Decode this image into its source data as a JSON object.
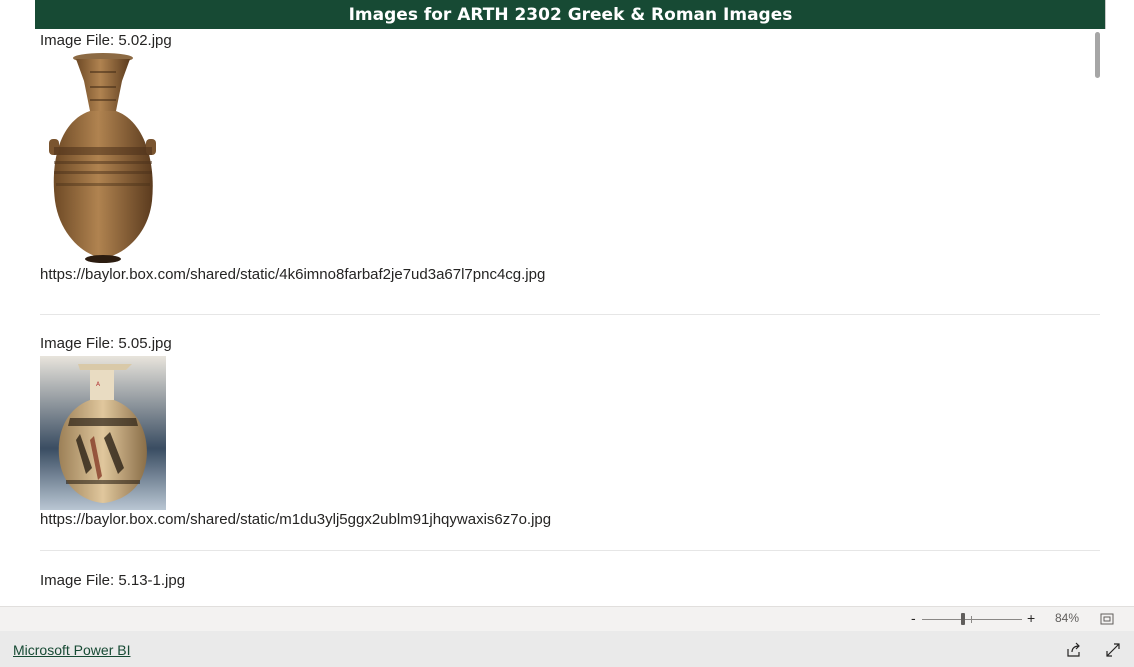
{
  "header": {
    "title": "Images for ARTH 2302 Greek & Roman Images"
  },
  "records": [
    {
      "file_label": "Image File: 5.02.jpg",
      "image_icon": "amphora-image",
      "url": "https://baylor.box.com/shared/static/4k6imno8farbaf2je7ud3a67l7pnc4cg.jpg"
    },
    {
      "file_label": "Image File: 5.05.jpg",
      "image_icon": "hydria-image",
      "url": "https://baylor.box.com/shared/static/m1du3ylj5ggx2ublm91jhqywaxis6z7o.jpg"
    },
    {
      "file_label": "Image File: 5.13-1.jpg"
    }
  ],
  "footer": {
    "zoom_minus": "-",
    "zoom_plus": "+",
    "zoom_value": "84%",
    "zoom_level": 0.42,
    "fit_icon": "fit-to-page-icon"
  },
  "bottom": {
    "link_label": "Microsoft Power BI",
    "share_icon": "share-icon",
    "expand_icon": "expand-icon"
  },
  "colors": {
    "title_bg": "#174a34",
    "title_text": "#ffffff",
    "link": "#174a34"
  }
}
